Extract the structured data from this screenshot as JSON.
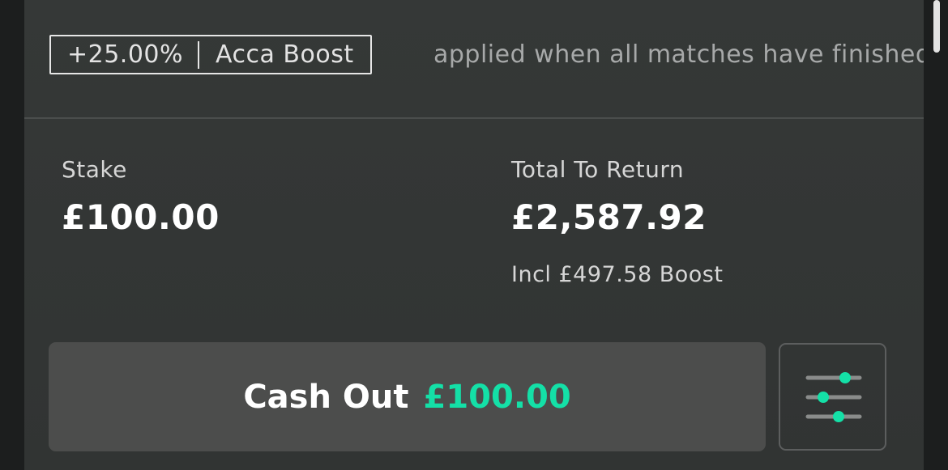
{
  "boost": {
    "percent": "+25.00%",
    "name": "Acca Boost",
    "note": "applied when all matches have finished"
  },
  "stake": {
    "label": "Stake",
    "value": "£100.00"
  },
  "total_return": {
    "label": "Total To Return",
    "value": "£2,587.92",
    "boost_note": "Incl £497.58 Boost"
  },
  "cash_out": {
    "label": "Cash Out",
    "amount": "£100.00"
  },
  "settings": {
    "icon": "sliders-icon"
  },
  "colors": {
    "accent": "#14e0a7",
    "card_background": "#343736",
    "button_background": "#4c4d4c"
  }
}
